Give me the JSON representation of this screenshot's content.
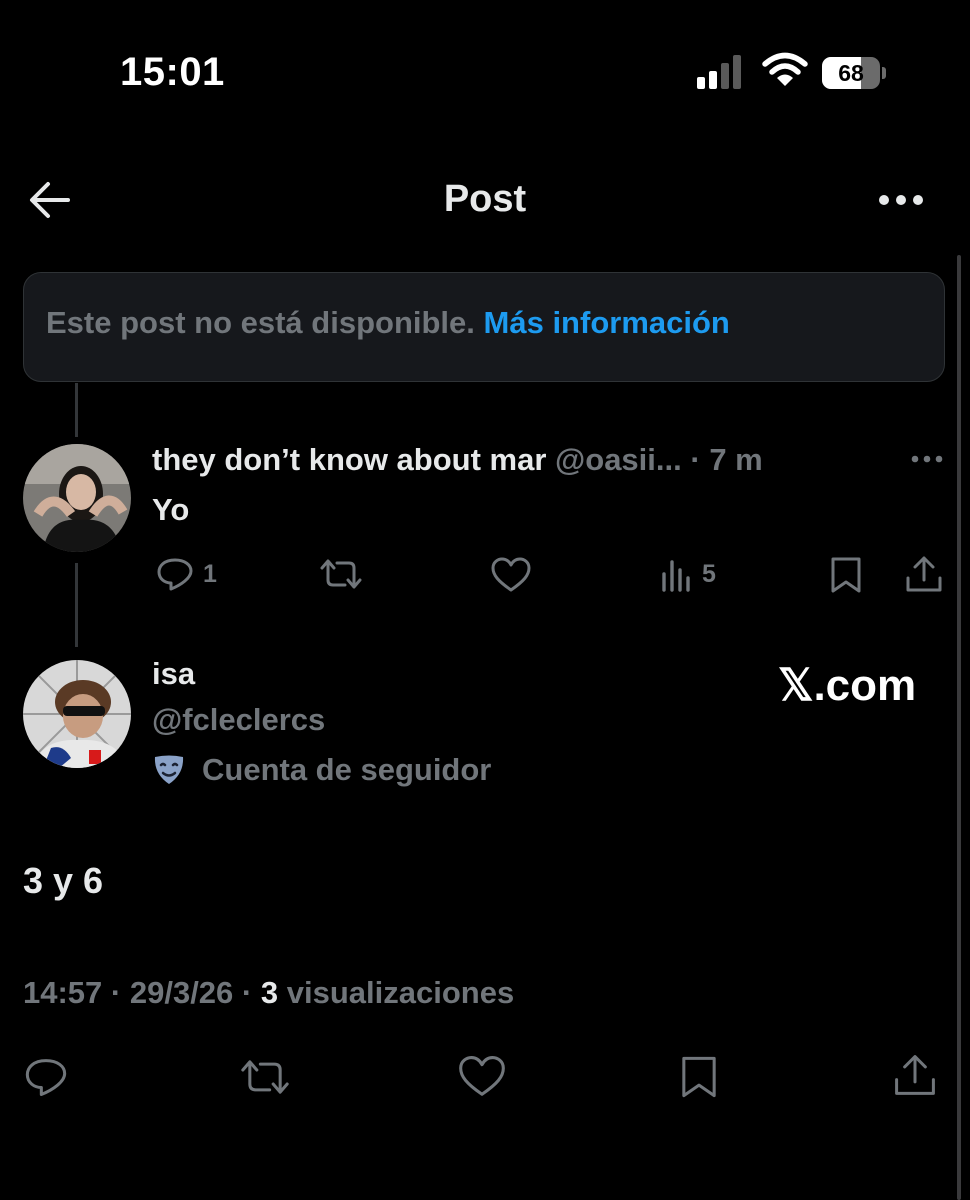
{
  "status_bar": {
    "time": "15:01",
    "battery_level": "68",
    "icons": [
      "cellular-signal-icon",
      "wifi-icon",
      "battery-icon"
    ]
  },
  "header": {
    "title": "Post",
    "icons": [
      "back-arrow-icon",
      "more-options-icon"
    ]
  },
  "unavailable": {
    "message": "Este post no está disponible.",
    "link": "Más información"
  },
  "reply_post": {
    "display_name": "they don’t know about mar",
    "handle": "@oasii...",
    "separator": " · ",
    "time": "7 m",
    "text": "Yo",
    "replies": "1",
    "views": "5",
    "icons": [
      "reply-icon",
      "repost-icon",
      "like-icon",
      "views-icon",
      "bookmark-icon",
      "share-icon",
      "more-icon"
    ]
  },
  "main_post": {
    "display_name": "isa",
    "handle": "@fcleclercs",
    "badge_label": "Cuenta de seguidor",
    "watermark": "𝕏.com",
    "text": "3 y 6",
    "timestamp": "14:57",
    "date": "29/3/26",
    "separator": " · ",
    "views_count": "3",
    "views_label": "visualizaciones",
    "icons": [
      "reply-icon",
      "repost-icon",
      "like-icon",
      "bookmark-icon",
      "share-icon",
      "fan-account-masks-icon"
    ]
  },
  "colors": {
    "background": "#000000",
    "text_primary": "#e7e9ea",
    "text_secondary": "#71767b",
    "accent": "#1d9bf0",
    "card_border": "#2f3336"
  }
}
